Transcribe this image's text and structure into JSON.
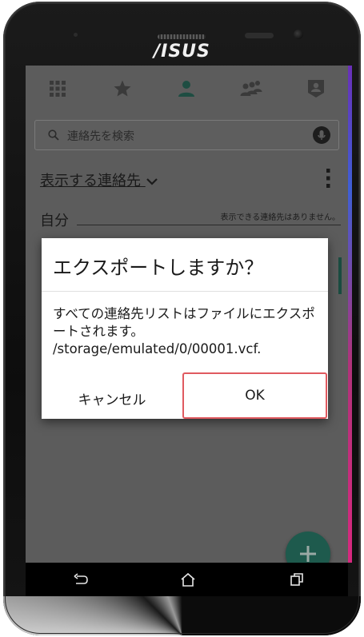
{
  "device": {
    "brand_text": "/ISUS"
  },
  "tabs": [
    {
      "icon": "grid-icon",
      "active": false
    },
    {
      "icon": "star-icon",
      "active": false
    },
    {
      "icon": "person-icon",
      "active": true
    },
    {
      "icon": "group-icon",
      "active": false
    },
    {
      "icon": "badge-icon",
      "active": false
    }
  ],
  "search": {
    "placeholder": "連絡先を検索"
  },
  "contacts": {
    "filter_label": "表示する連絡先",
    "self_label": "自分",
    "empty_note": "表示できる連絡先はありません。"
  },
  "dialog": {
    "title": "エクスポートしますか？",
    "message": "すべての連絡先リストはファイルにエクスポートされます。 /storage/emulated/0/00001.vcf.",
    "cancel_label": "キャンセル",
    "ok_label": "OK"
  },
  "colors": {
    "accent": "#1e5a4d",
    "highlight_border": "#e05a60"
  }
}
